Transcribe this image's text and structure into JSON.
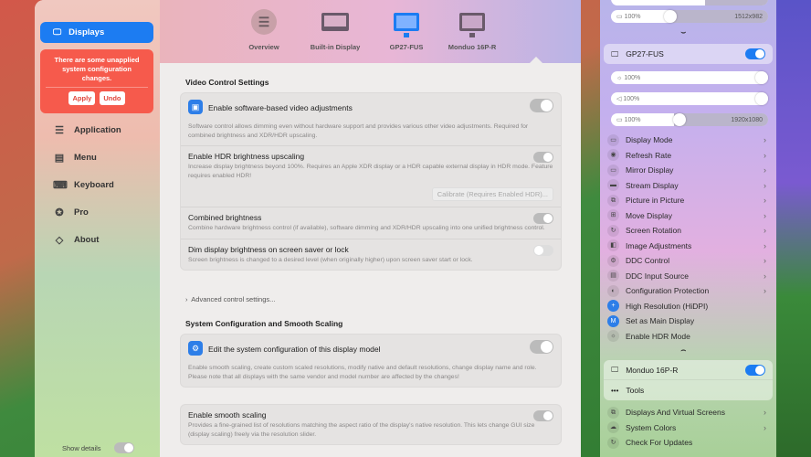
{
  "sidebar": {
    "selected": "Displays",
    "alert": {
      "message": "There are some unapplied system configuration changes.",
      "apply": "Apply",
      "undo": "Undo"
    },
    "items": [
      {
        "label": "Application"
      },
      {
        "label": "Menu"
      },
      {
        "label": "Keyboard"
      },
      {
        "label": "Pro"
      },
      {
        "label": "About"
      }
    ],
    "show_details": "Show details"
  },
  "tabs": [
    {
      "label": "Overview"
    },
    {
      "label": "Built-in Display"
    },
    {
      "label": "GP27-FUS"
    },
    {
      "label": "Monduo 16P-R"
    }
  ],
  "video": {
    "title": "Video Control Settings",
    "software": {
      "title": "Enable software-based video adjustments",
      "desc": "Software control allows dimming even without hardware support and provides various other video adjustments. Required for combined brightness and XDR/HDR upscaling."
    },
    "hdr": {
      "title": "Enable HDR brightness upscaling",
      "desc": "Increase display brightness beyond 100%. Requires an Apple XDR display or a HDR capable external display in HDR mode. Feature requires enabled HDR!",
      "button": "Calibrate (Requires Enabled HDR)..."
    },
    "combined": {
      "title": "Combined brightness",
      "desc": "Combine hardware brightness control (if available), software dimming and XDR/HDR upscaling into one unified brightness control."
    },
    "dim": {
      "title": "Dim display brightness on screen saver or lock",
      "desc": "Screen brightness is changed to a desired level (when originally higher) upon screen saver start or lock."
    },
    "advanced": "Advanced control settings..."
  },
  "sysconf": {
    "title": "System Configuration and Smooth Scaling",
    "edit": {
      "title": "Edit the system configuration of this display model",
      "desc": "Enable smooth scaling, create custom scaled resolutions, modify native and default resolutions, change display name and role. Please note that all displays with the same vendor and model number are affected by the changes!"
    },
    "smooth": {
      "title": "Enable smooth scaling",
      "desc": "Provides a fine-grained list of resolutions matching the aspect ratio of the display's native resolution. This lets change GUI size (display scaling) freely via the resolution slider."
    }
  },
  "menu": {
    "builtin_res": {
      "value": "100%",
      "res": "1512x982"
    },
    "gp27": {
      "name": "GP27-FUS",
      "brightness": "100%",
      "volume": "100%",
      "resolution": "100%",
      "res": "1920x1080"
    },
    "items": [
      {
        "label": "Display Mode"
      },
      {
        "label": "Refresh Rate"
      },
      {
        "label": "Mirror Display"
      },
      {
        "label": "Stream Display"
      },
      {
        "label": "Picture in Picture"
      },
      {
        "label": "Move Display"
      },
      {
        "label": "Screen Rotation"
      },
      {
        "label": "Image Adjustments"
      },
      {
        "label": "DDC Control"
      },
      {
        "label": "DDC Input Source"
      },
      {
        "label": "Configuration Protection"
      },
      {
        "label": "High Resolution (HiDPI)"
      },
      {
        "label": "Set as Main Display"
      },
      {
        "label": "Enable HDR Mode"
      }
    ],
    "monduo": "Monduo 16P-R",
    "tools": "Tools",
    "footer": [
      {
        "label": "Displays And Virtual Screens"
      },
      {
        "label": "System Colors"
      },
      {
        "label": "Check For Updates"
      }
    ]
  }
}
